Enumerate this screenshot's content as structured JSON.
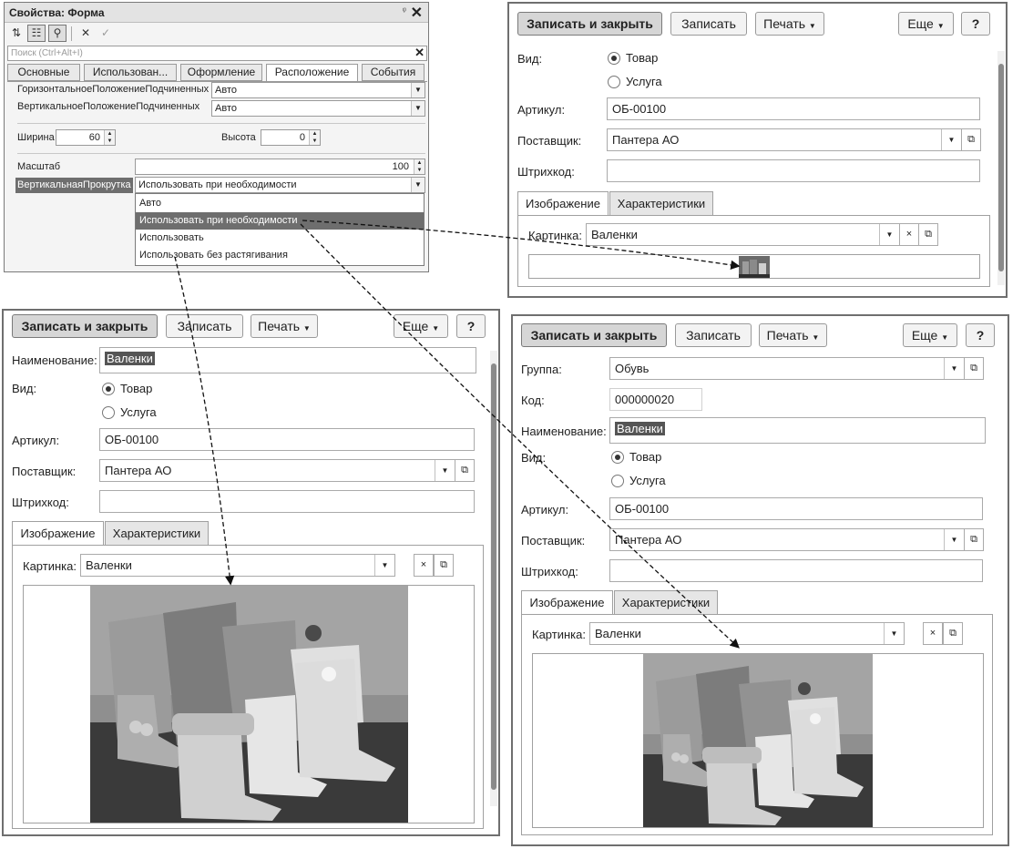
{
  "props": {
    "title": "Свойства: Форма",
    "pin": "ᵠ",
    "close": "✕",
    "search_placeholder": "Поиск (Ctrl+Alt+I)",
    "search_clear": "✕",
    "tabs": [
      "Основные",
      "Использован...",
      "Оформление",
      "Расположение",
      "События"
    ],
    "active_tab": "Расположение",
    "horiz_label": "ГоризонтальноеПоложениеПодчиненных",
    "horiz_value": "Авто",
    "vert_label": "ВертикальноеПоложениеПодчиненных",
    "vert_value": "Авто",
    "width_label": "Ширина",
    "width_value": "60",
    "height_label": "Высота",
    "height_value": "0",
    "scale_label": "Масштаб",
    "scale_value": "100",
    "vscroll_label": "ВертикальнаяПрокрутка",
    "vscroll_value": "Использовать при необходимости",
    "options": [
      "Авто",
      "Использовать при необходимости",
      "Использовать",
      "Использовать без растягивания"
    ],
    "selected_option": "Использовать при необходимости"
  },
  "forms": {
    "buttons": {
      "save_close": "Записать и закрыть",
      "save": "Записать",
      "print": "Печать",
      "more": "Еще",
      "help": "?"
    },
    "labels": {
      "group": "Группа:",
      "code": "Код:",
      "name": "Наименование:",
      "kind": "Вид:",
      "article": "Артикул:",
      "supplier": "Поставщик:",
      "barcode": "Штрихкод:",
      "picture": "Картинка:"
    },
    "values": {
      "group": "Обувь",
      "code": "000000020",
      "name": "Валенки",
      "article": "ОБ-00100",
      "supplier": "Пантера АО",
      "barcode": "",
      "picture": "Валенки"
    },
    "kind_options": [
      "Товар",
      "Услуга"
    ],
    "kind_selected": "Товар",
    "tabs": [
      "Изображение",
      "Характеристики"
    ],
    "active_tab": "Изображение"
  },
  "icons": [
    "sort-icon",
    "categories-icon",
    "filter-icon",
    "cancel-icon",
    "check-icon",
    "dropdown-arrow-icon",
    "clear-icon",
    "open-icon",
    "spin-icon"
  ],
  "colors": {
    "selection": "#6e6e6e",
    "main_button": "#d6d6d6",
    "frame": "#6f6f6f"
  }
}
